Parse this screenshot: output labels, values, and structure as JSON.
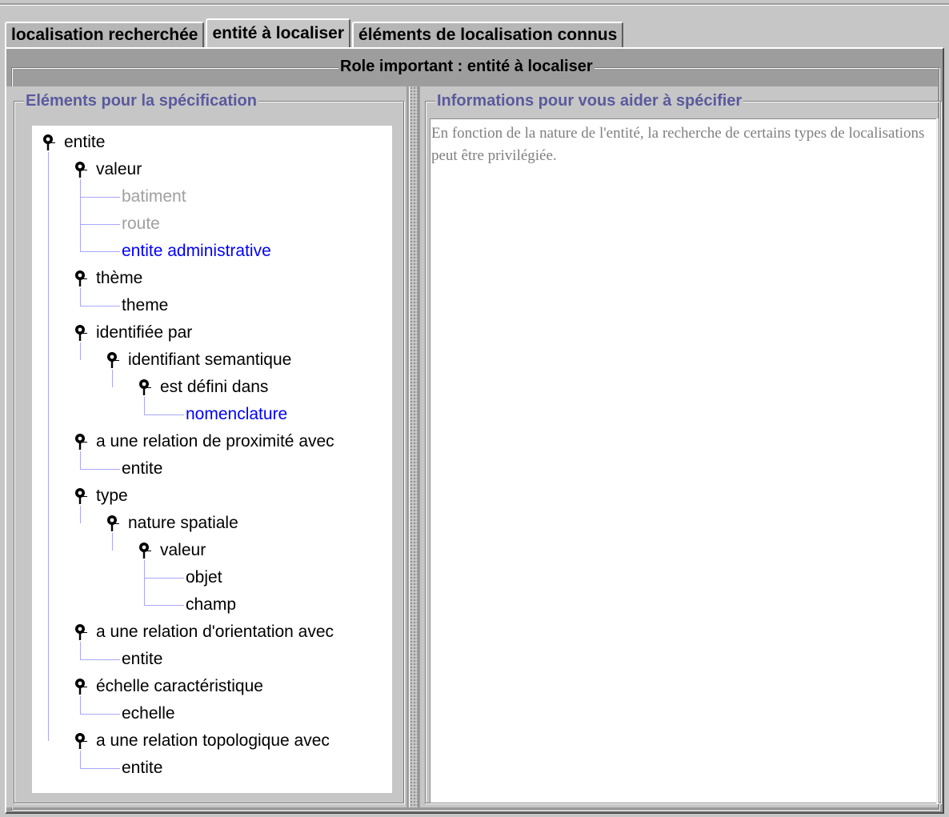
{
  "tabs": [
    {
      "label": "localisation recherchée",
      "active": false
    },
    {
      "label": "entité à localiser",
      "active": true
    },
    {
      "label": "éléments de localisation connus",
      "active": false
    }
  ],
  "role_panel": {
    "title": "Role important : entité à localiser"
  },
  "left_panel": {
    "title": "Eléments pour la spécification"
  },
  "right_panel": {
    "title": "Informations pour vous aider à spécifier",
    "text": "En fonction de la nature de l'entité, la recherche de certains types de localisations peut être privilégiée."
  },
  "tree": {
    "colors": {
      "normal": "#000000",
      "disabled": "#a0a0a0",
      "selected": "#0000ff",
      "lines": "#a7a7ff"
    },
    "nodes": [
      {
        "label": "entite",
        "depth": 0,
        "state": "normal",
        "expandable": true
      },
      {
        "label": "valeur",
        "depth": 1,
        "state": "normal",
        "expandable": true
      },
      {
        "label": "batiment",
        "depth": 2,
        "state": "disabled",
        "expandable": false
      },
      {
        "label": "route",
        "depth": 2,
        "state": "disabled",
        "expandable": false
      },
      {
        "label": "entite administrative",
        "depth": 2,
        "state": "selected",
        "expandable": false
      },
      {
        "label": "thème",
        "depth": 1,
        "state": "normal",
        "expandable": true
      },
      {
        "label": "theme",
        "depth": 2,
        "state": "normal",
        "expandable": false
      },
      {
        "label": "identifiée par",
        "depth": 1,
        "state": "normal",
        "expandable": true
      },
      {
        "label": "identifiant semantique",
        "depth": 2,
        "state": "normal",
        "expandable": true
      },
      {
        "label": "est défini dans",
        "depth": 3,
        "state": "normal",
        "expandable": true
      },
      {
        "label": "nomenclature",
        "depth": 4,
        "state": "selected",
        "expandable": false
      },
      {
        "label": "a une relation de proximité avec",
        "depth": 1,
        "state": "normal",
        "expandable": true
      },
      {
        "label": "entite",
        "depth": 2,
        "state": "normal",
        "expandable": false
      },
      {
        "label": "type",
        "depth": 1,
        "state": "normal",
        "expandable": true
      },
      {
        "label": "nature spatiale",
        "depth": 2,
        "state": "normal",
        "expandable": true
      },
      {
        "label": "valeur",
        "depth": 3,
        "state": "normal",
        "expandable": true
      },
      {
        "label": "objet",
        "depth": 4,
        "state": "normal",
        "expandable": false
      },
      {
        "label": "champ",
        "depth": 4,
        "state": "normal",
        "expandable": false
      },
      {
        "label": "a une relation d'orientation avec",
        "depth": 1,
        "state": "normal",
        "expandable": true
      },
      {
        "label": "entite",
        "depth": 2,
        "state": "normal",
        "expandable": false
      },
      {
        "label": "échelle caractéristique",
        "depth": 1,
        "state": "normal",
        "expandable": true
      },
      {
        "label": "echelle",
        "depth": 2,
        "state": "normal",
        "expandable": false
      },
      {
        "label": "a une relation topologique avec",
        "depth": 1,
        "state": "normal",
        "expandable": true
      },
      {
        "label": "entite",
        "depth": 2,
        "state": "normal",
        "expandable": false
      }
    ]
  }
}
